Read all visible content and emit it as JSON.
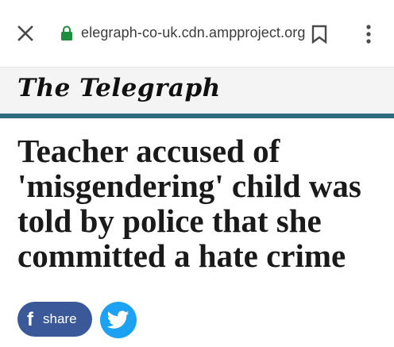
{
  "browser": {
    "url": "elegraph-co-uk.cdn.ampproject.org",
    "close_icon": "close-icon",
    "lock_icon": "lock-icon",
    "bookmark_icon": "bookmark-icon",
    "menu_icon": "more-vert-icon",
    "lock_color": "#1e8e3e"
  },
  "masthead": {
    "logo_text": "The Telegraph",
    "rule_color": "#2e6b7e"
  },
  "article": {
    "headline": "Teacher accused of 'misgendering' child was told by police that she committed a hate crime"
  },
  "share": {
    "facebook_label": "share",
    "facebook_glyph": "f",
    "facebook_color": "#3b5998",
    "twitter_icon": "twitter-bird-icon",
    "twitter_color": "#1da1f2"
  }
}
